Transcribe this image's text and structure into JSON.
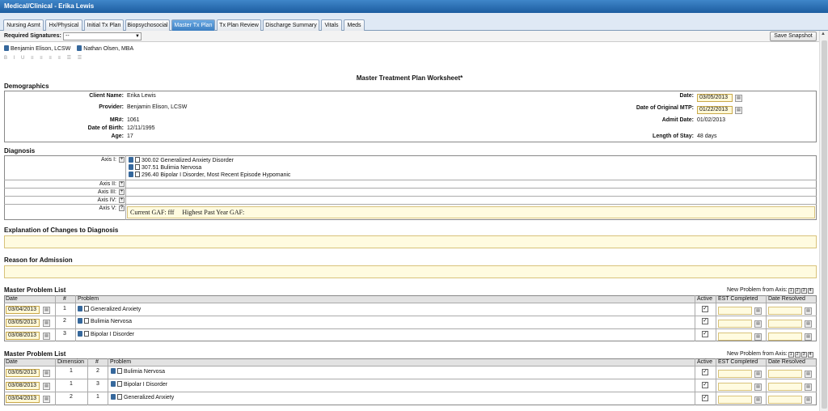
{
  "window_title": "Medical/Clinical - Erika Lewis",
  "tabs": [
    "Nursing Asmt",
    "Hx/Physical",
    "Initial Tx Plan",
    "Biopsychosocial",
    "Master Tx Plan",
    "Tx Plan Review",
    "Discharge Summary",
    "Vitals",
    "Meds"
  ],
  "active_tab": "Master Tx Plan",
  "signatures": {
    "label": "Required Signatures:",
    "selected": "--",
    "signers": [
      "Benjamin Elison, LCSW",
      "Nathan Olsen, MBA"
    ]
  },
  "save_snapshot": "Save Snapshot",
  "toolbar_glyphs": "B I U",
  "worksheet_title": "Master Treatment Plan Worksheet*",
  "demographics": {
    "heading": "Demographics",
    "client_name_label": "Client Name:",
    "client_name": "Erika Lewis",
    "provider_label": "Provider:",
    "provider": "Benjamin Elison, LCSW",
    "mr_label": "MR#:",
    "mr": "1061",
    "dob_label": "Date of Birth:",
    "dob": "12/11/1995",
    "age_label": "Age:",
    "age": "17",
    "date_label": "Date:",
    "date": "03/05/2013",
    "orig_mtp_label": "Date of Original MTP:",
    "orig_mtp": "01/22/2013",
    "admit_label": "Admit Date:",
    "admit": "01/02/2013",
    "los_label": "Length of Stay:",
    "los": "48 days"
  },
  "diagnosis": {
    "heading": "Diagnosis",
    "axis1_label": "Axis I:",
    "axis1": [
      "300.02 Generalized Anxiety Disorder",
      "307.51 Bulimia Nervosa",
      "296.40 Bipolar I Disorder, Most Recent Episode Hypomanic"
    ],
    "axis2_label": "Axis II:",
    "axis3_label": "Axis III:",
    "axis4_label": "Axis IV:",
    "axis5_label": "Axis V:",
    "gaf_current_label": "Current GAF:",
    "gaf_current": "fff",
    "gaf_highest_label": "Highest Past Year GAF:"
  },
  "explanation": {
    "heading": "Explanation of Changes to Diagnosis"
  },
  "admission": {
    "heading": "Reason for Admission"
  },
  "problem_list_1": {
    "heading": "Master Problem List",
    "new_label": "New Problem from Axis:",
    "axes": [
      "1",
      "2",
      "3",
      "4"
    ],
    "columns": [
      "Date",
      "#",
      "Problem",
      "Active",
      "EST Completed",
      "Date Resolved"
    ],
    "rows": [
      {
        "date": "03/04/2013",
        "num": "1",
        "problem": "Generalized Anxiety",
        "active": true
      },
      {
        "date": "03/05/2013",
        "num": "2",
        "problem": "Bulimia Nervosa",
        "active": true
      },
      {
        "date": "03/08/2013",
        "num": "3",
        "problem": "Bipolar I Disorder",
        "active": true
      }
    ]
  },
  "problem_list_2": {
    "heading": "Master Problem List",
    "new_label": "New Problem from Axis:",
    "axes": [
      "1",
      "2",
      "3",
      "4"
    ],
    "columns": [
      "Date",
      "Dimension",
      "#",
      "Problem",
      "Active",
      "EST Completed",
      "Date Resolved"
    ],
    "rows": [
      {
        "date": "03/05/2013",
        "dimension": "1",
        "num": "2",
        "problem": "Bulimia Nervosa",
        "active": true
      },
      {
        "date": "03/08/2013",
        "dimension": "1",
        "num": "3",
        "problem": "Bipolar I Disorder",
        "active": true
      },
      {
        "date": "03/04/2013",
        "dimension": "2",
        "num": "1",
        "problem": "Generalized Anxiety",
        "active": true
      }
    ]
  }
}
